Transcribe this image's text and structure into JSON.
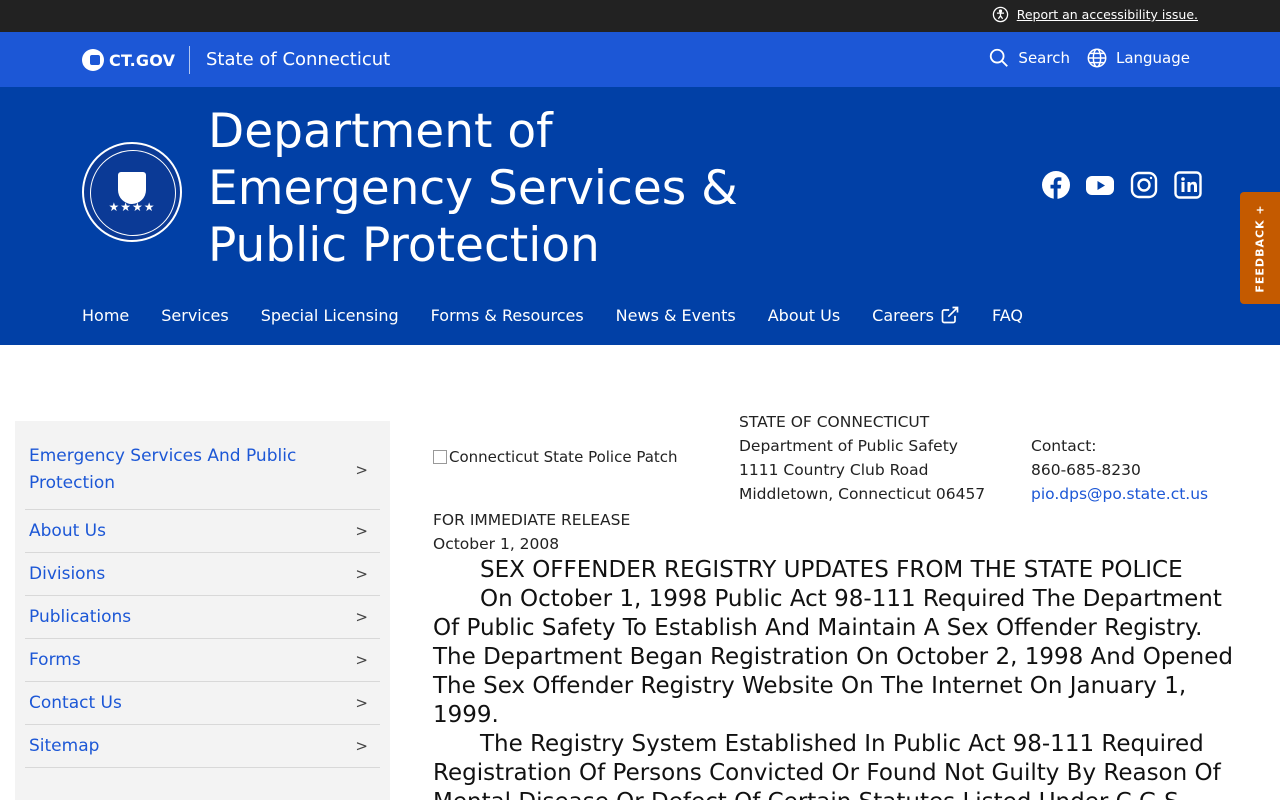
{
  "a11y": {
    "report_link": "Report an accessibility issue."
  },
  "ct_bar": {
    "logo_text": "CT.GOV",
    "state_name": "State of Connecticut",
    "search_label": "Search",
    "language_label": "Language"
  },
  "agency": {
    "title_line1": "Department of",
    "title_line2": "Emergency Services &",
    "title_line3": "Public Protection"
  },
  "nav": [
    {
      "label": "Home"
    },
    {
      "label": "Services"
    },
    {
      "label": "Special Licensing"
    },
    {
      "label": "Forms & Resources"
    },
    {
      "label": "News & Events"
    },
    {
      "label": "About Us"
    },
    {
      "label": "Careers"
    },
    {
      "label": "FAQ"
    }
  ],
  "feedback": {
    "label": "FEEDBACK +"
  },
  "sidebar": [
    {
      "label": "Emergency Services And Public Protection"
    },
    {
      "label": "About Us"
    },
    {
      "label": "Divisions"
    },
    {
      "label": "Publications"
    },
    {
      "label": "Forms"
    },
    {
      "label": "Contact Us"
    },
    {
      "label": "Sitemap"
    }
  ],
  "content": {
    "patch_alt": "Connecticut State Police Patch",
    "address": {
      "line1": "STATE OF CONNECTICUT",
      "line2": "Department of Public Safety",
      "line3": "1111 Country Club Road",
      "line4": "Middletown, Connecticut 06457"
    },
    "contact": {
      "label": "Contact:",
      "phone": "860-685-8230",
      "email": "pio.dps@po.state.ct.us"
    },
    "release": "FOR IMMEDIATE RELEASE",
    "date": "October 1, 2008",
    "headline": "SEX OFFENDER REGISTRY UPDATES FROM THE STATE POLICE",
    "para1": "On October 1, 1998 Public Act 98-111 Required The Department Of Public Safety To Establish And Maintain A Sex Offender Registry. The Department Began Registration On October 2, 1998 And Opened The Sex Offender Registry Website On The Internet On January 1, 1999.",
    "para2": "The Registry System Established In Public Act 98-111 Required Registration Of Persons Convicted Or Found Not Guilty By Reason Of Mental Disease Or Defect Of Certain Statutes Listed Under C.G.S."
  },
  "colors": {
    "ct_blue": "#1c57d6",
    "agency_blue": "#0140a6",
    "feedback_orange": "#c45a00",
    "top_bar": "#222222"
  }
}
